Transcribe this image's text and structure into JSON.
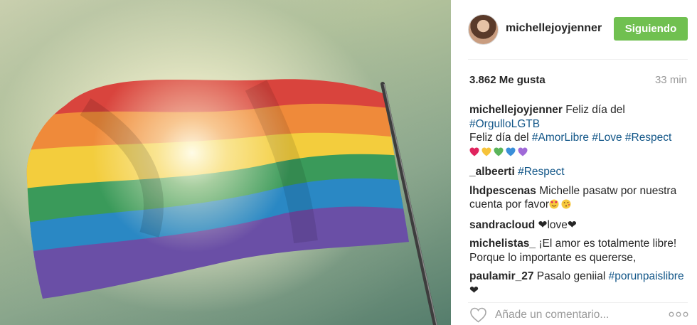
{
  "post": {
    "image_alt": "rainbow-flag-photo"
  },
  "header": {
    "username": "michellejoyjenner",
    "follow_label": "Siguiendo"
  },
  "stats": {
    "likes": "3.862 Me gusta",
    "time": "33 min"
  },
  "comments": [
    {
      "user": "michellejoyjenner",
      "parts": [
        {
          "t": "text",
          "v": " Feliz día del "
        },
        {
          "t": "tag",
          "v": "#OrgulloLGTB"
        },
        {
          "t": "br"
        },
        {
          "t": "text",
          "v": "Feliz día del "
        },
        {
          "t": "tag",
          "v": "#AmorLibre"
        },
        {
          "t": "text",
          "v": " "
        },
        {
          "t": "tag",
          "v": "#Love"
        },
        {
          "t": "text",
          "v": " "
        },
        {
          "t": "tag",
          "v": "#Respect"
        },
        {
          "t": "br"
        },
        {
          "t": "emojis",
          "v": [
            "red-heart",
            "yellow-heart",
            "green-heart",
            "blue-heart",
            "purple-heart"
          ]
        }
      ]
    },
    {
      "user": "_albeerti",
      "parts": [
        {
          "t": "text",
          "v": " "
        },
        {
          "t": "tag",
          "v": "#Respect"
        }
      ]
    },
    {
      "user": "lhdpescenas",
      "parts": [
        {
          "t": "text",
          "v": " Michelle pasatw por nuestra cuenta por favor"
        },
        {
          "t": "emojis",
          "v": [
            "heart-eyes-face",
            "kiss-face"
          ]
        }
      ]
    },
    {
      "user": "sandracloud",
      "parts": [
        {
          "t": "text",
          "v": " ❤love❤"
        }
      ]
    },
    {
      "user": "michelistas_",
      "parts": [
        {
          "t": "text",
          "v": " ¡El amor es totalmente libre! Porque lo importante es quererse,"
        }
      ]
    },
    {
      "user": "paulamir_27",
      "parts": [
        {
          "t": "text",
          "v": " Pasalo geniial "
        },
        {
          "t": "tag",
          "v": "#porunpaislibre"
        },
        {
          "t": "text",
          "v": "❤"
        }
      ]
    }
  ],
  "add_comment": {
    "placeholder": "Añade un comentario..."
  },
  "colors": {
    "follow_green": "#70c050",
    "hashtag_blue": "#125688",
    "muted_gray": "#999999"
  }
}
